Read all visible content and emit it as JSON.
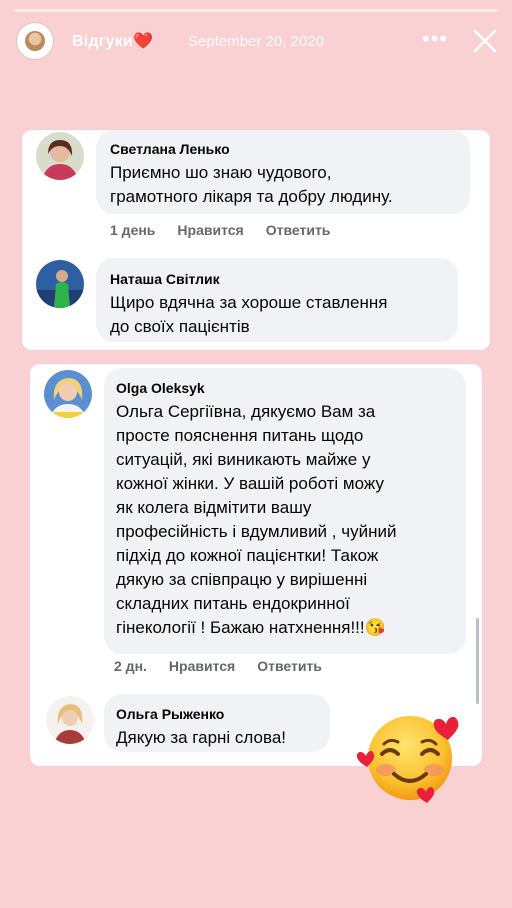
{
  "story": {
    "title": "Відгуки",
    "title_emoji": "❤️",
    "date": "September 20, 2020",
    "more_label": "•••"
  },
  "comments": [
    {
      "author": "Светлана Ленько",
      "text": "Приємно шо знаю чудового,\nграмотного лікаря та добру людину.",
      "time": "1 день",
      "like": "Нравится",
      "reply": "Ответить"
    },
    {
      "author": "Наташа Світлик",
      "text": "Щиро вдячна за хороше ставлення\nдо своїх пацієнтів"
    },
    {
      "author": "Olga Oleksyk",
      "text": "Ольга Сергіївна, дякуємо Вам за\nпросте пояснення питань  щодо\nситуацій, які виникають майже у\nкожної жінки. У вашій роботі можу\nяк колега відмітити вашу\nпрофесійність і вдумливий   , чуйний\nпідхід до кожної пацієнтки! Також\nдякую за співпрацю у вирішенні\nскладних питань ендокринної\nгінекології ! Бажаю натхнення!!!😘",
      "time": "2 дн.",
      "like": "Нравится",
      "reply": "Ответить"
    },
    {
      "author": "Ольга Рыженко",
      "text": "Дякую за гарні слова!"
    }
  ],
  "colors": {
    "background": "#f9d1d3",
    "bubble": "#f0f2f5",
    "meta_text": "#65676b"
  },
  "sticker": "smiling-face-with-hearts"
}
